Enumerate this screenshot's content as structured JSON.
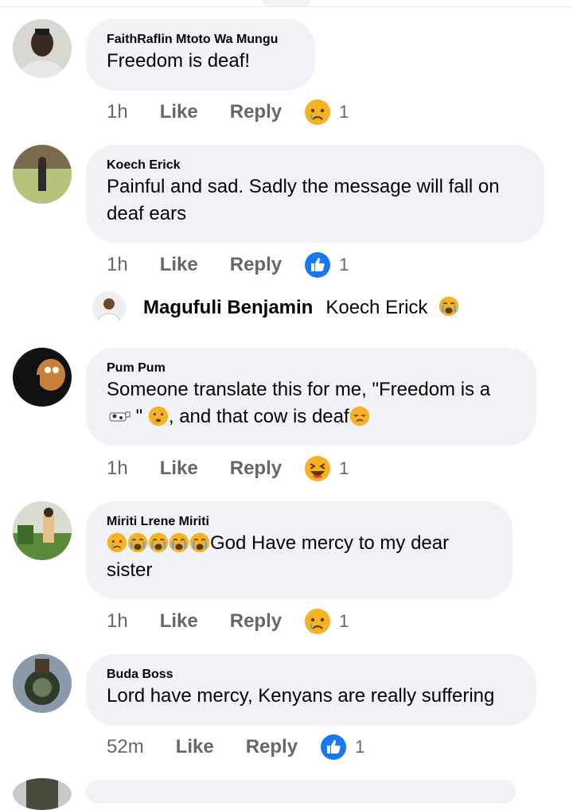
{
  "comments": [
    {
      "author": "FaithRaflin Mtoto Wa Mungu",
      "text": "Freedom is deaf!",
      "time": "1h",
      "like": "Like",
      "reply": "Reply",
      "reaction_icon": "sad-reaction-icon",
      "reaction_count": "1"
    },
    {
      "author": "Koech Erick",
      "text_line1": "Painful and sad. Sadly the message will fall on",
      "text_line2": "deaf ears",
      "time": "1h",
      "like": "Like",
      "reply": "Reply",
      "reaction_icon": "like-reaction-icon",
      "reaction_count": "1"
    },
    {
      "author": "Pum Pum",
      "text_line1": "Someone translate this for me, \"Freedom is a",
      "text_line2_a": " \" ",
      "text_line2_b": ", and that cow is deaf",
      "time": "1h",
      "like": "Like",
      "reply": "Reply",
      "reaction_icon": "haha-reaction-icon",
      "reaction_count": "1"
    },
    {
      "author": "Miriti Lrene Miriti",
      "text_line1": "God Have mercy to my dear",
      "text_line2": "sister",
      "time": "1h",
      "like": "Like",
      "reply": "Reply",
      "reaction_icon": "sad-reaction-icon",
      "reaction_count": "1"
    },
    {
      "author": "Buda Boss",
      "text": "Lord have mercy, Kenyans are really suffering",
      "time": "52m",
      "like": "Like",
      "reply": "Reply",
      "reaction_icon": "like-reaction-icon",
      "reaction_count": "1"
    }
  ],
  "reply_preview": {
    "author": "Magufuli Benjamin",
    "text": "Koech Erick"
  },
  "colors": {
    "bubble": "#f0f2f5",
    "meta": "#65676b",
    "like_blue": "#1877f2",
    "emoji_yellow": "#f7b125"
  }
}
